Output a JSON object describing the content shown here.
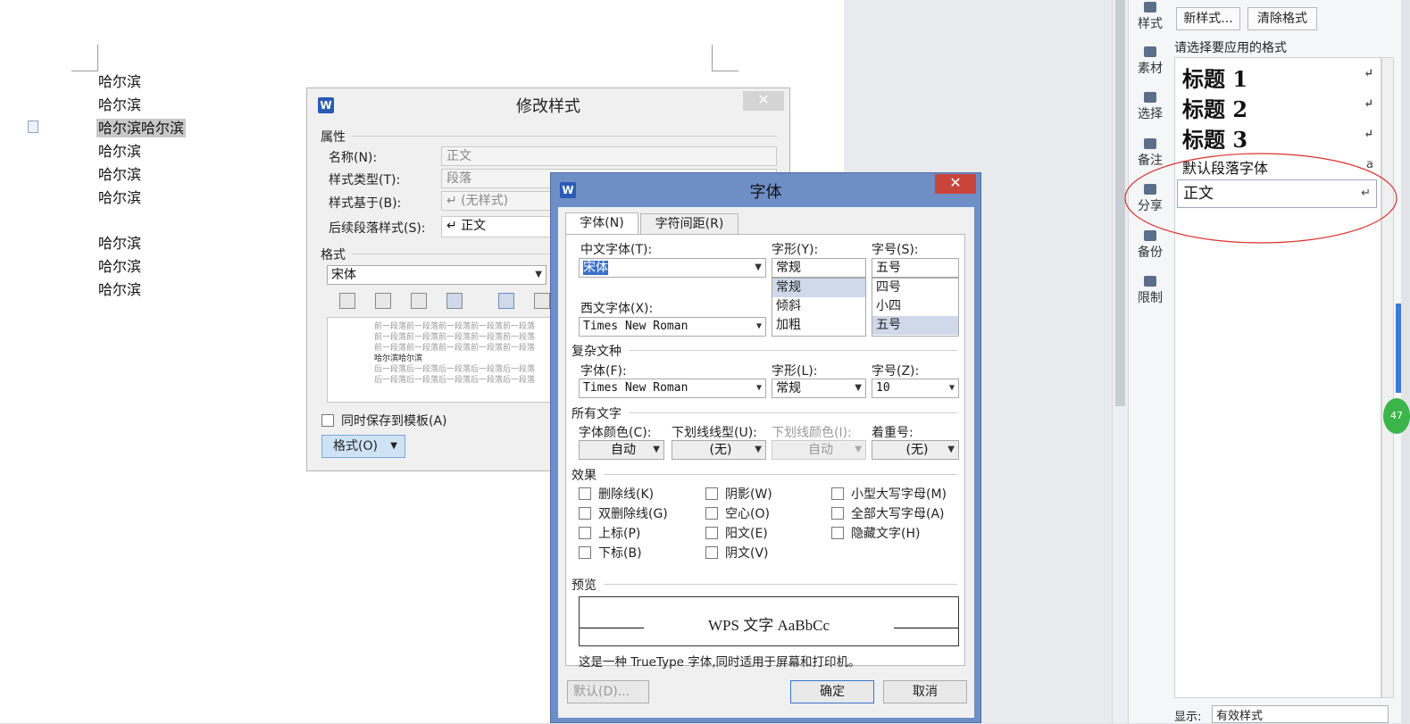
{
  "document": {
    "lines": [
      "哈尔滨",
      "哈尔滨",
      "哈尔滨哈尔滨",
      "哈尔滨",
      "哈尔滨",
      "哈尔滨",
      "哈尔滨",
      "哈尔滨",
      "哈尔滨"
    ]
  },
  "toolbar_right": {
    "items": [
      "样式",
      "素材",
      "选择",
      "备注",
      "分享",
      "备份",
      "限制"
    ]
  },
  "style_pane": {
    "new_style": "新样式...",
    "clear_format": "清除格式",
    "prompt": "请选择要应用的格式",
    "styles": [
      "标题 1",
      "标题 2",
      "标题 3",
      "默认段落字体",
      "正文"
    ],
    "show_label": "显示:",
    "show_value": "有效样式"
  },
  "modify_style": {
    "title": "修改样式",
    "section_props": "属性",
    "name_label": "名称(N):",
    "name_value": "正文",
    "type_label": "样式类型(T):",
    "type_value": "段落",
    "based_label": "样式基于(B):",
    "based_value": "↵ (无样式)",
    "next_label": "后续段落样式(S):",
    "next_value": "↵ 正文",
    "section_format": "格式",
    "font_value": "宋体",
    "preview_lines": [
      "前一段落前一段落前一段落前一段落前一段落",
      "前一段落前一段落前一段落前一段落前一段落",
      "前一段落前一段落前一段落前一段落前一段落",
      "哈尔滨哈尔滨",
      "后一段落后一段落后一段落后一段落后一段落",
      "后一段落后一段落后一段落后一段落后一段落"
    ],
    "save_template": "同时保存到模板(A)",
    "format_btn": "格式(O)"
  },
  "font_dialog": {
    "title": "字体",
    "tab_font": "字体(N)",
    "tab_spacing": "字符间距(R)",
    "cn_font_label": "中文字体(T):",
    "cn_font_value": "宋体",
    "style_label": "字形(Y):",
    "style_value": "常规",
    "style_options": [
      "常规",
      "倾斜",
      "加粗"
    ],
    "size_label": "字号(S):",
    "size_value": "五号",
    "size_options": [
      "四号",
      "小四",
      "五号"
    ],
    "west_font_label": "西文字体(X):",
    "west_font_value": "Times New Roman",
    "complex_section": "复杂文种",
    "complex_font_label": "字体(F):",
    "complex_font_value": "Times New Roman",
    "complex_style_label": "字形(L):",
    "complex_style_value": "常规",
    "complex_size_label": "字号(Z):",
    "complex_size_value": "10",
    "all_text_section": "所有文字",
    "color_label": "字体颜色(C):",
    "color_value": "自动",
    "underline_label": "下划线线型(U):",
    "underline_value": "(无)",
    "underline_color_label": "下划线颜色(I):",
    "underline_color_value": "自动",
    "emphasis_label": "着重号:",
    "emphasis_value": "(无)",
    "effects_section": "效果",
    "effects": [
      "删除线(K)",
      "阴影(W)",
      "小型大写字母(M)",
      "双删除线(G)",
      "空心(O)",
      "全部大写字母(A)",
      "上标(P)",
      "阳文(E)",
      "隐藏文字(H)",
      "下标(B)",
      "阴文(V)"
    ],
    "preview_section": "预览",
    "preview_text": "WPS 文字 AaBbCc",
    "truetype_note": "这是一种 TrueType 字体,同时适用于屏幕和打印机。",
    "default_btn": "默认(D)...",
    "ok_btn": "确定",
    "cancel_btn": "取消"
  },
  "badge": "47",
  "colors": {
    "accent": "#2a5bb5",
    "close": "#c9443b",
    "highlight": "#cfd9ea",
    "circle": "#d9302e"
  }
}
